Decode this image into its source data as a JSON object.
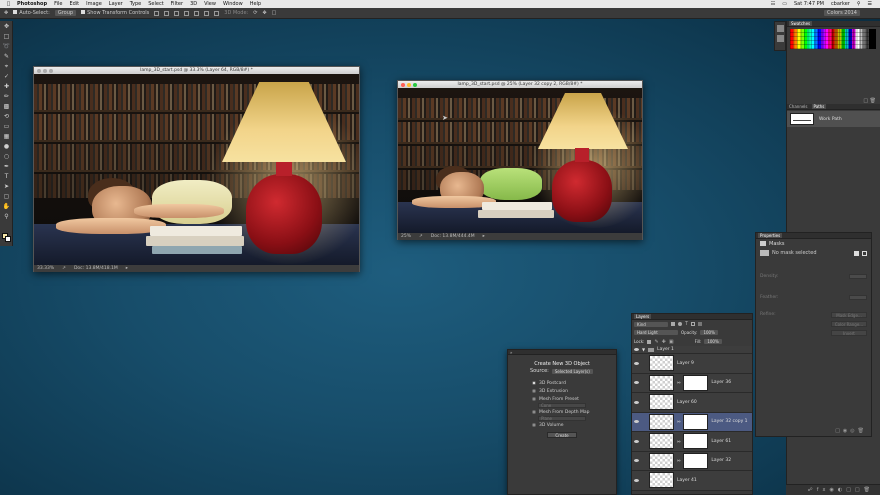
{
  "menubar": {
    "app": "Photoshop",
    "items": [
      "File",
      "Edit",
      "Image",
      "Layer",
      "Type",
      "Select",
      "Filter",
      "3D",
      "View",
      "Window",
      "Help"
    ],
    "clock": "Sat 7:47 PM",
    "user": "cbarker"
  },
  "options": {
    "auto_select": "Auto-Select:",
    "auto_select_value": "Group",
    "transform": "Show Transform Controls",
    "mode3d": "3D Mode:",
    "workspace": "Colors 2014"
  },
  "doc1": {
    "title": "lamp_3D_start.psd @ 33.3% (Layer 64, RGB/8#) *",
    "zoom": "33.33%",
    "info": "Doc: 13.8M/418.1M"
  },
  "doc2": {
    "title": "lamp_3D_start.psd @ 25% (Layer 32 copy 2, RGB/8#) *",
    "zoom": "25%",
    "info": "Doc: 13.8M/444.4M"
  },
  "swatches": {
    "title": "Swatches"
  },
  "paths": {
    "tabs": [
      "Channels",
      "Paths"
    ],
    "item": "Work Path"
  },
  "properties": {
    "title": "Properties",
    "section": "Masks",
    "status": "No mask selected",
    "density": "Density:",
    "feather": "Feather:",
    "refine": "Refine:",
    "buttons": [
      "Mask Edge...",
      "Color Range...",
      "Invert"
    ]
  },
  "layers": {
    "title": "Layers",
    "kind": "Kind",
    "blend": "Hard Light",
    "opacity_label": "Opacity:",
    "opacity": "100%",
    "lock_label": "Lock:",
    "fill_label": "Fill:",
    "fill": "100%",
    "group": "Layer 1",
    "rows": [
      {
        "name": "Layer 9",
        "mask": false
      },
      {
        "name": "Layer 36",
        "mask": true
      },
      {
        "name": "Layer 60",
        "mask": false
      },
      {
        "name": "Layer 32 copy 1",
        "mask": true
      },
      {
        "name": "Layer 61",
        "mask": true
      },
      {
        "name": "Layer 32",
        "mask": true
      },
      {
        "name": "Layer 41",
        "mask": false
      }
    ]
  },
  "dialog3d": {
    "title": "Create New 3D Object",
    "source_label": "Source:",
    "source": "Selected Layer(s)",
    "options": [
      "3D Postcard",
      "3D Extrusion",
      "Mesh From Preset",
      "Mesh From Depth Map",
      "3D Volume"
    ],
    "preset": "Cone",
    "depth": "Plane",
    "button": "Create"
  },
  "colors": {
    "menubar": "#e8e8e8",
    "panel": "#3a3a3a",
    "selected_layer": "#4c5a82",
    "background": "#174d6a"
  }
}
